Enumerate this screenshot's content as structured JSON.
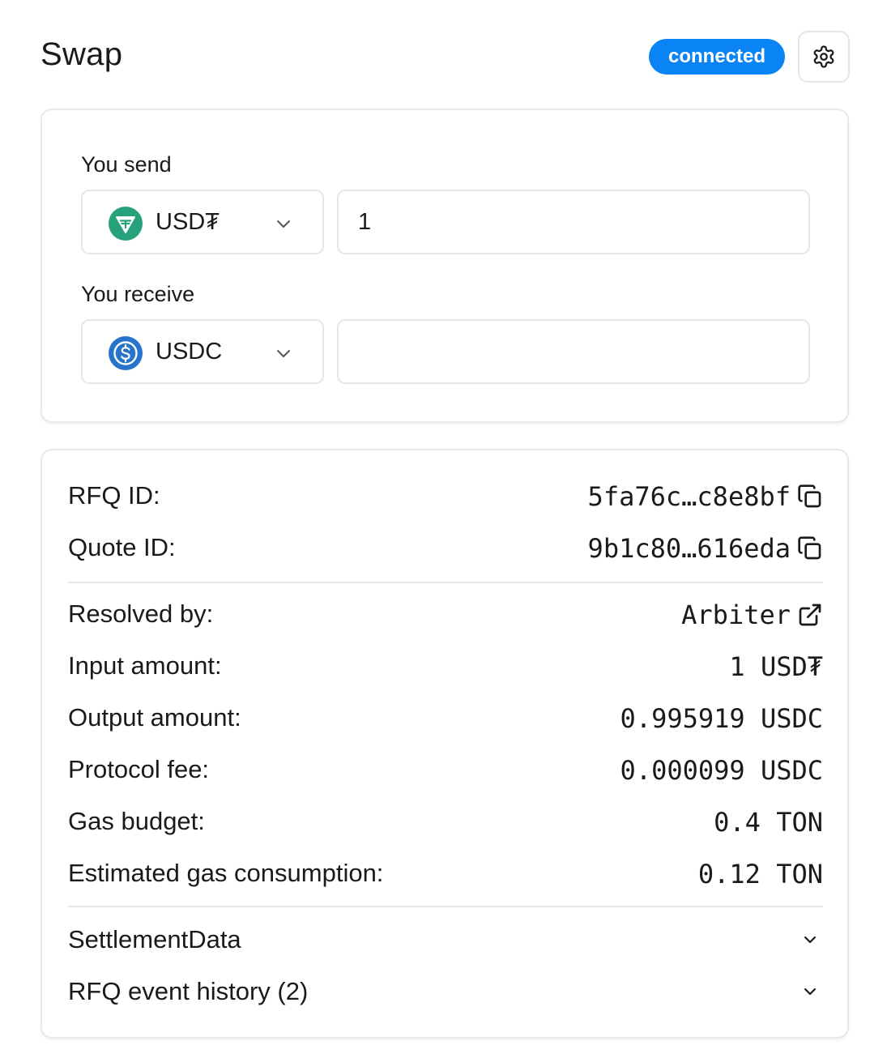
{
  "header": {
    "title": "Swap",
    "status_badge": "connected",
    "settings_icon": "gear-icon"
  },
  "swap": {
    "send": {
      "label": "You send",
      "token": "USD₮",
      "token_icon": "tether-icon",
      "amount": "1"
    },
    "receive": {
      "label": "You receive",
      "token": "USDC",
      "token_icon": "usdc-icon",
      "amount": ""
    }
  },
  "details": {
    "rfq_id": {
      "label": "RFQ ID:",
      "value": "5fa76c…c8e8bf"
    },
    "quote_id": {
      "label": "Quote ID:",
      "value": "9b1c80…616eda"
    },
    "resolved_by": {
      "label": "Resolved by:",
      "value": "Arbiter"
    },
    "input_amount": {
      "label": "Input amount:",
      "value": "1 USD₮"
    },
    "output_amount": {
      "label": "Output amount:",
      "value": "0.995919 USDC"
    },
    "protocol_fee": {
      "label": "Protocol fee:",
      "value": "0.000099 USDC"
    },
    "gas_budget": {
      "label": "Gas budget:",
      "value": "0.4 TON"
    },
    "est_gas": {
      "label": "Estimated gas consumption:",
      "value": "0.12 TON"
    },
    "settlement": {
      "label": "SettlementData"
    },
    "history": {
      "label": "RFQ event history (2)"
    }
  },
  "colors": {
    "accent": "#0a84f5",
    "tether": "#26a17b",
    "usdc": "#2775ca",
    "border": "#e6e8ec"
  }
}
